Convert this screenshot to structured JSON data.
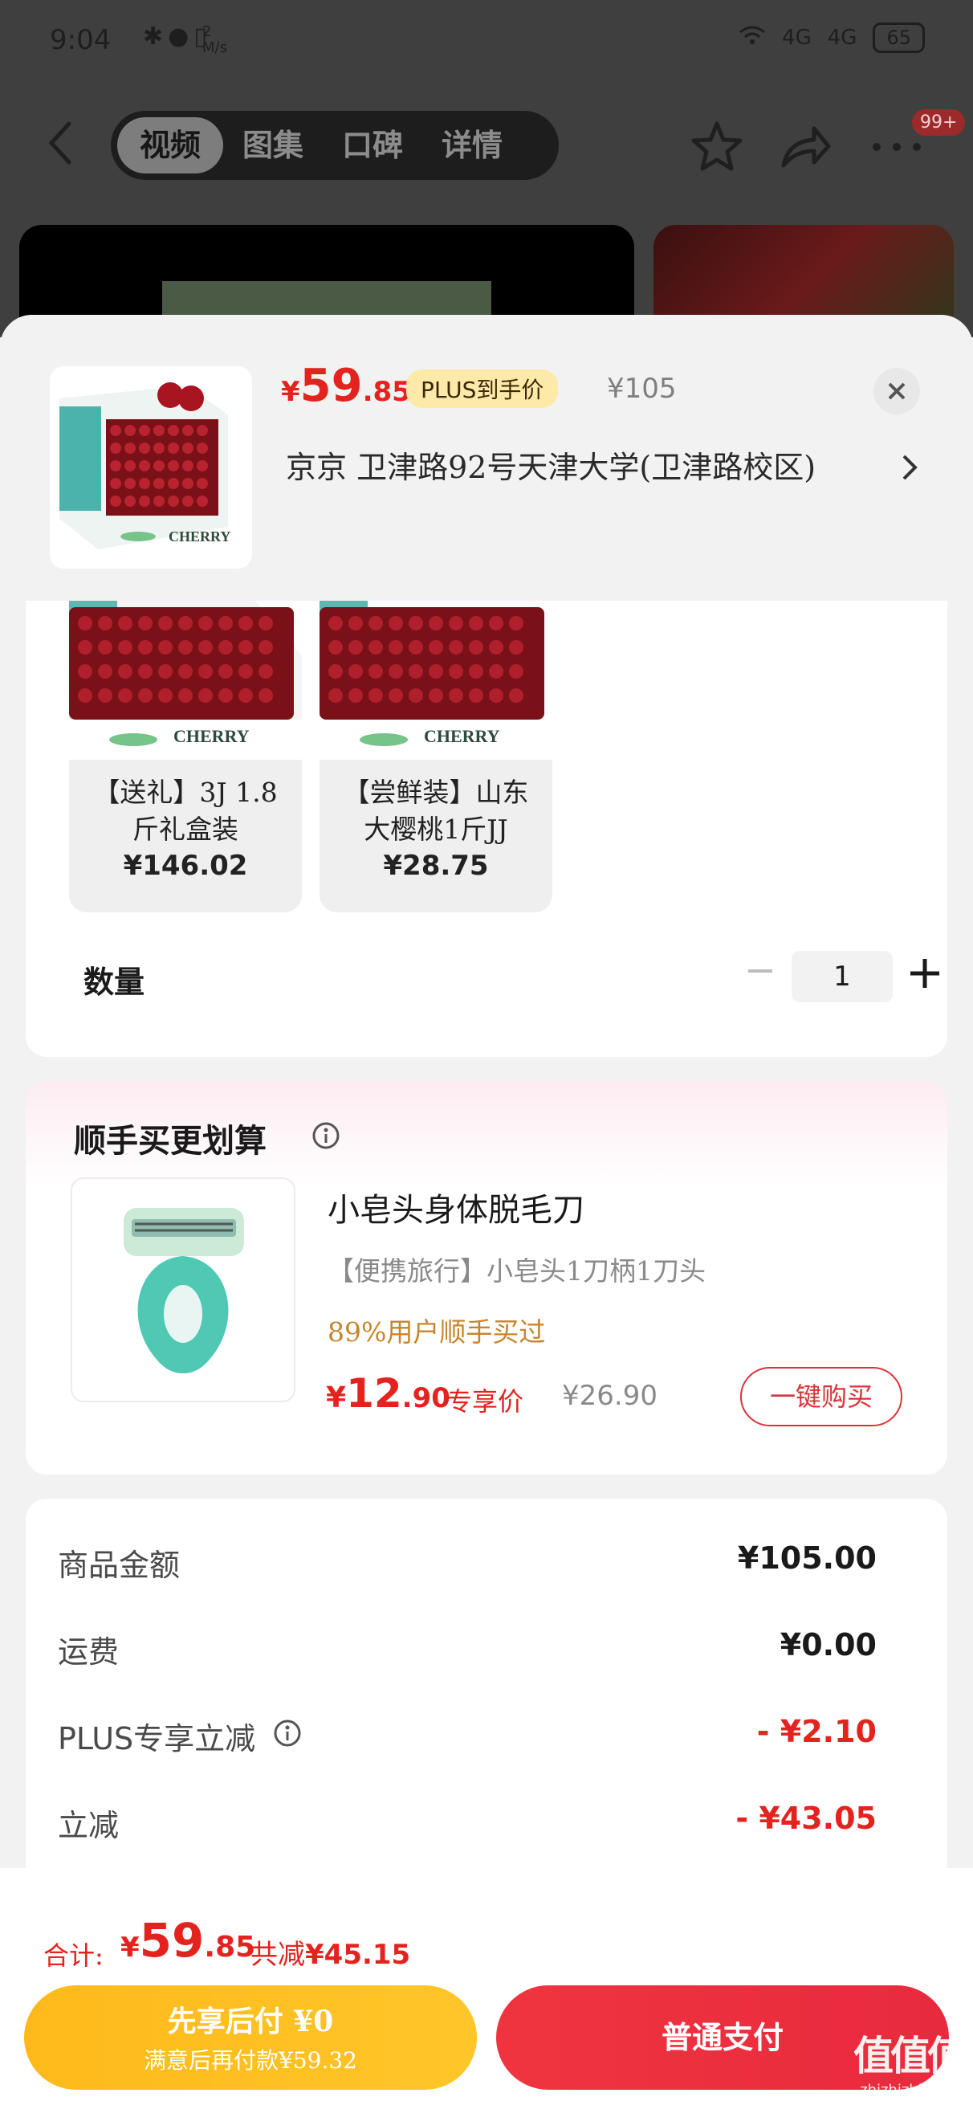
{
  "status_bar": {
    "time": "9:04",
    "speed_value": "2",
    "speed_unit": "M/s",
    "network_1": "4G",
    "network_2": "4G",
    "battery": "65"
  },
  "nav": {
    "tabs": [
      {
        "label": "视频"
      },
      {
        "label": "图集"
      },
      {
        "label": "口碑"
      },
      {
        "label": "详情"
      }
    ],
    "message_badge": "99+"
  },
  "product": {
    "price_yen": "¥",
    "price_int": "59",
    "price_dec": ".85",
    "plus_tag": "PLUS到手价",
    "original_price": "¥105",
    "address": "京京   卫津路92号天津大学(卫津路校区)",
    "thumbnail_brand": "CHERRY"
  },
  "variants": [
    {
      "name": "【送礼】3J 1.8斤礼盒装",
      "price": "¥146.02",
      "img_text": "CHERRY"
    },
    {
      "name": "【尝鲜装】山东大樱桃1斤JJ",
      "price": "¥28.75",
      "img_text": "CHERRY"
    }
  ],
  "quantity": {
    "label": "数量",
    "value": "1"
  },
  "upsell": {
    "title": "顺手买更划算",
    "item_name": "小皂头身体脱毛刀",
    "item_desc": "【便携旅行】小皂头1刀柄1刀头",
    "social_proof": "89%用户顺手买过",
    "price_yen": "¥",
    "price_int": "12",
    "price_dec": ".90",
    "price_label": "专享价",
    "original_price": "¥26.90",
    "buy_button": "一键购买"
  },
  "summary": {
    "rows": [
      {
        "label": "商品金额",
        "value": "¥105.00"
      },
      {
        "label": "运费",
        "value": "¥0.00"
      },
      {
        "label": "PLUS专享立减",
        "value": "- ¥2.10"
      },
      {
        "label": "立减",
        "value": "- ¥43.05"
      }
    ]
  },
  "footer": {
    "total_label": "合计:",
    "total_yen": "¥",
    "total_int": "59",
    "total_dec": ".85",
    "saved_label": "共减",
    "saved_value": "¥45.15",
    "pay_later_title": "先享后付 ¥0",
    "pay_later_sub": "满意后再付款¥59.32",
    "pay_normal": "普通支付"
  },
  "watermark": {
    "logo": "值值值",
    "domain": "zhizhizhi.com"
  },
  "colors": {
    "accent_red": "#e4231e",
    "pay_later_yellow": "#ffb91a",
    "plus_tag_bg": "#fde9a8",
    "social_proof_orange": "#c8842b"
  },
  "icons": [
    "back-arrow-icon",
    "star-icon",
    "share-icon",
    "more-icon",
    "close-icon",
    "chevron-right-icon",
    "info-icon",
    "minus-icon",
    "plus-icon"
  ]
}
